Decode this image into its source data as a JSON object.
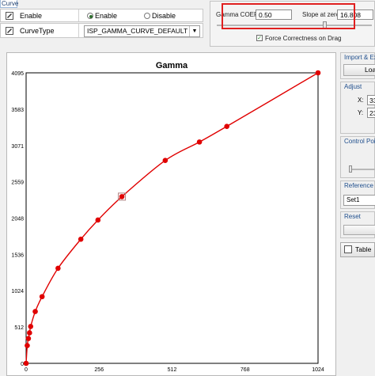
{
  "tab": {
    "label": "Curve"
  },
  "settings": {
    "enable": {
      "label": "Enable",
      "options": [
        "Enable",
        "Disable"
      ],
      "selected": "Enable"
    },
    "curve_type": {
      "label": "CurveType",
      "value": "ISP_GAMMA_CURVE_DEFAULT"
    }
  },
  "gamma_panel": {
    "coeff_label": "Gamma COEFFI:",
    "coeff_value": "0.50",
    "slope_label": "Slope at zero:",
    "slope_value": "16.808",
    "force_label": "Force Correctness on Drag",
    "force_checked": true,
    "highlight_color": "#e02020"
  },
  "sidebar": {
    "import_export": {
      "title": "Import & Exp",
      "button": "Load"
    },
    "adjust": {
      "title": "Adjust",
      "x_label": "X:",
      "x_value": "33",
      "y_label": "Y:",
      "y_value": "23"
    },
    "control_points": {
      "title": "Control Point"
    },
    "reference": {
      "title": "Reference Se",
      "value": "Set1"
    },
    "reset": {
      "title": "Reset"
    },
    "table_button": "Table"
  },
  "chart_data": {
    "type": "line",
    "title": "Gamma",
    "xlabel": "",
    "ylabel": "",
    "xlim": [
      0,
      1024
    ],
    "ylim": [
      0,
      4095
    ],
    "grid": true,
    "x_ticks": [
      "0",
      "256",
      "512",
      "768",
      "1024"
    ],
    "y_ticks": [
      "0",
      "512",
      "1024",
      "1536",
      "2048",
      "2559",
      "3071",
      "3583",
      "4095"
    ],
    "series": [
      {
        "color": "#e00000",
        "points": [
          [
            0,
            0
          ],
          [
            4,
            250
          ],
          [
            8,
            350
          ],
          [
            12,
            430
          ],
          [
            16,
            520
          ],
          [
            32,
            730
          ],
          [
            56,
            940
          ],
          [
            112,
            1340
          ],
          [
            192,
            1750
          ],
          [
            252,
            2020
          ],
          [
            336,
            2350
          ],
          [
            488,
            2860
          ],
          [
            608,
            3120
          ],
          [
            704,
            3340
          ],
          [
            1024,
            4095
          ]
        ],
        "selected_point": [
          336,
          2350
        ]
      }
    ]
  }
}
